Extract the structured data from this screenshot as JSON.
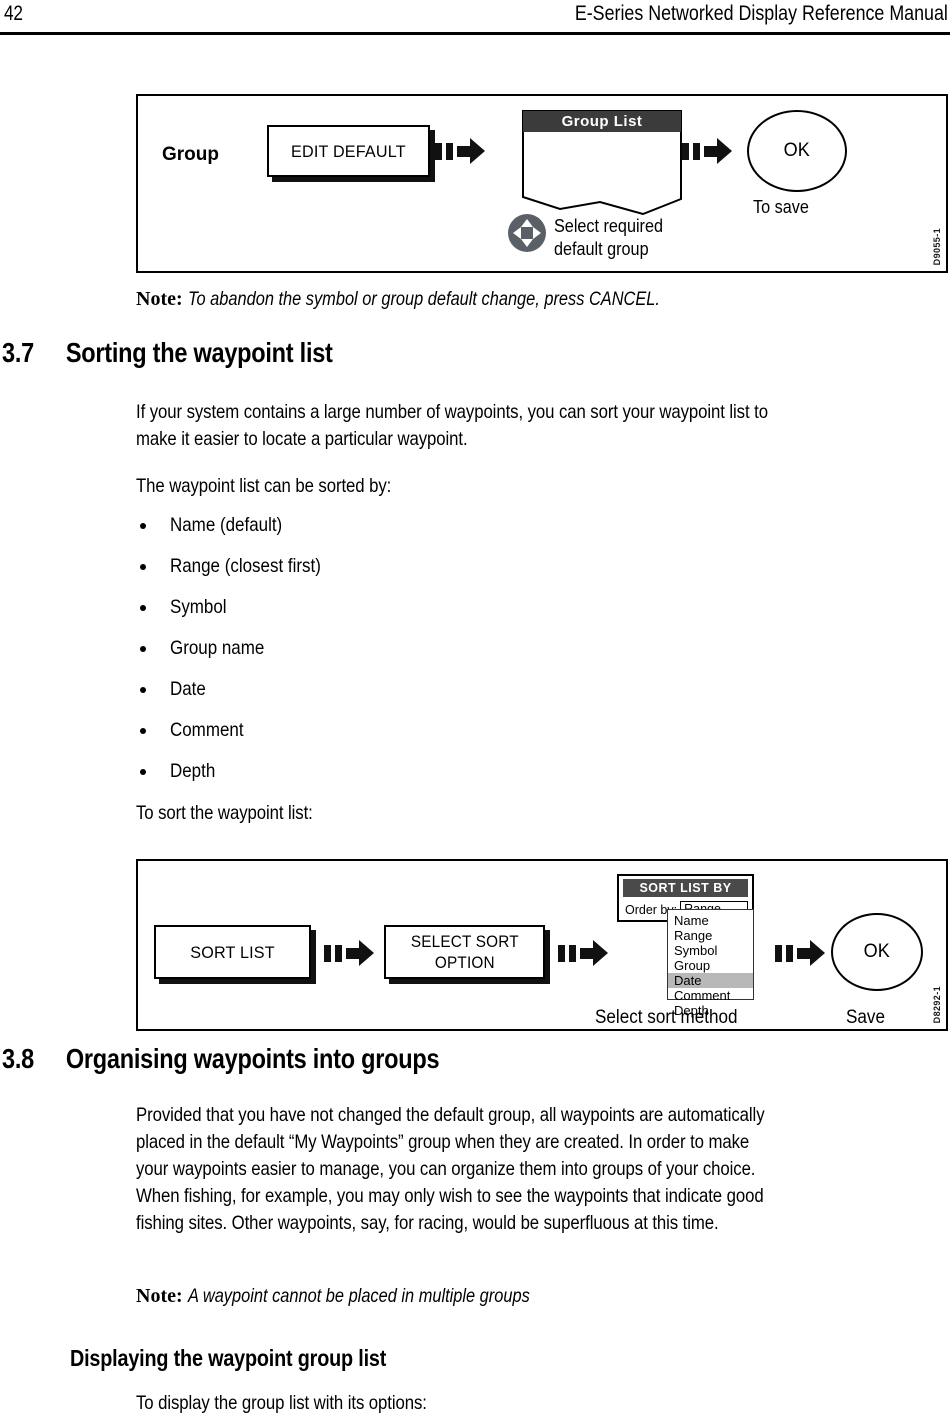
{
  "header": {
    "page_number": "42",
    "manual_title": "E-Series Networked Display Reference Manual"
  },
  "figure_group_default": {
    "id_label": "D9055-1",
    "row_label": "Group",
    "softkey_label": "EDIT DEFAULT",
    "panel_title": "Group List",
    "dpad_icon": "dpad-icon",
    "dpad_caption_line1": "Select required",
    "dpad_caption_line2": "default group",
    "ok_label": "OK",
    "ok_caption": "To save",
    "arrow_icon": "arrow-right-icon"
  },
  "note_1": {
    "label": "Note:",
    "text": "To abandon the symbol or group default change, press CANCEL."
  },
  "section_37": {
    "number": "3.7",
    "title": "Sorting the waypoint list",
    "paragraph_1": "If your system contains a large number of waypoints, you can sort your waypoint list to make it easier to locate a particular waypoint.",
    "paragraph_1_lines": [
      "If your system contains a large number of waypoints, you can sort your waypoint list to",
      "make it easier to locate a particular waypoint."
    ],
    "paragraph_2": "The waypoint list can be sorted by:",
    "sort_options": [
      "Name (default)",
      "Range (closest first)",
      "Symbol",
      "Group name",
      "Date",
      "Comment",
      "Depth"
    ],
    "paragraph_3": "To sort the waypoint list:"
  },
  "figure_sort_list": {
    "id_label": "D8292-1",
    "softkey_1": "SORT LIST",
    "softkey_2_line1": "SELECT SORT",
    "softkey_2_line2": "OPTION",
    "dialog": {
      "title": "SORT LIST BY",
      "field_label": "Order by:",
      "field_value": "Range",
      "menu_items": [
        "Name",
        "Range",
        "Symbol",
        "Group",
        "Date",
        "Comment",
        "Depth"
      ],
      "menu_selected": "Date"
    },
    "dialog_caption": "Select sort method",
    "ok_label": "OK",
    "ok_caption": "Save",
    "arrow_icon": "arrow-right-icon"
  },
  "section_38": {
    "number": "3.8",
    "title": "Organising waypoints into groups",
    "paragraph_1_lines": [
      "Provided that you have not changed the default group, all waypoints are automatically",
      "placed in the default “My Waypoints” group when they are created. In order to make",
      "your waypoints easier to manage, you can organize them into groups of your choice.",
      "When fishing, for example, you may only wish to see the waypoints that indicate good",
      "fishing sites. Other waypoints, say, for racing, would be superfluous at this time."
    ],
    "note": {
      "label": "Note:",
      "text": "A waypoint cannot be placed in multiple groups"
    },
    "subsection_title": "Displaying the waypoint group list",
    "subsection_intro": "To display the group list with its options:"
  },
  "colors": {
    "panel_header_bg": "#3b3b3b",
    "dialog_header_bg": "#4a4a4a",
    "menu_selection_bg": "#b8b8b8",
    "dpad_bg": "#5a6068",
    "rule": "#000000"
  }
}
